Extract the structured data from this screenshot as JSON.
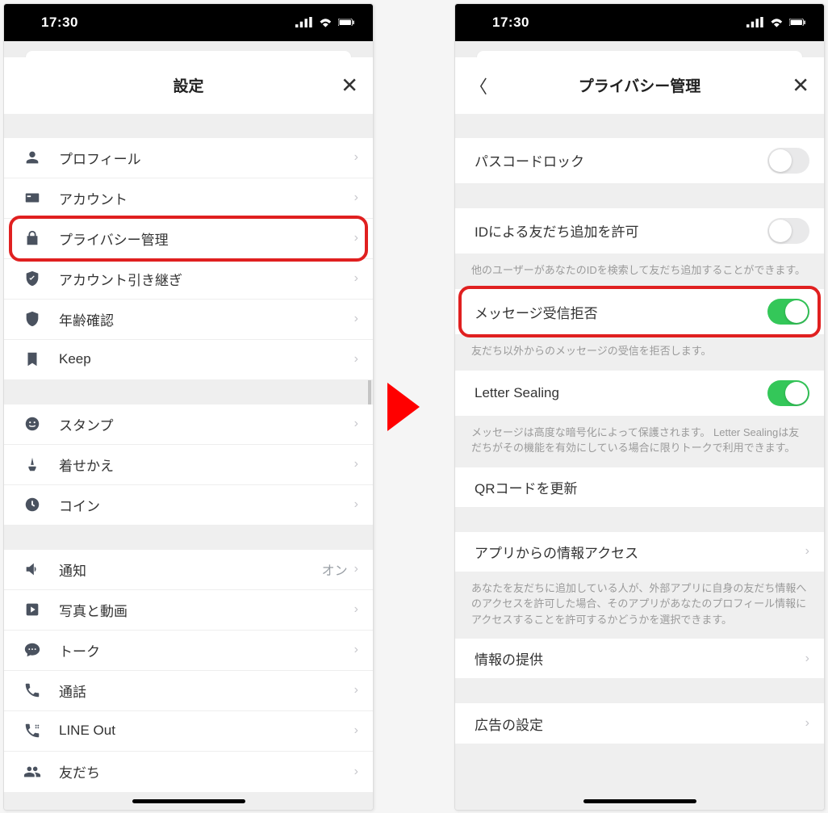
{
  "statusbar": {
    "time": "17:30"
  },
  "left": {
    "title": "設定",
    "groups": [
      [
        {
          "icon": "person",
          "label": "プロフィール"
        },
        {
          "icon": "id-card",
          "label": "アカウント"
        },
        {
          "icon": "lock",
          "label": "プライバシー管理",
          "highlight": true
        },
        {
          "icon": "shield-check",
          "label": "アカウント引き継ぎ"
        },
        {
          "icon": "shield",
          "label": "年齢確認"
        },
        {
          "icon": "bookmark",
          "label": "Keep"
        }
      ],
      [
        {
          "icon": "smile",
          "label": "スタンプ"
        },
        {
          "icon": "brush",
          "label": "着せかえ"
        },
        {
          "icon": "clock",
          "label": "コイン"
        }
      ],
      [
        {
          "icon": "speaker",
          "label": "通知",
          "value": "オン"
        },
        {
          "icon": "play-square",
          "label": "写真と動画"
        },
        {
          "icon": "chat",
          "label": "トーク"
        },
        {
          "icon": "phone",
          "label": "通話"
        },
        {
          "icon": "phone-out",
          "label": "LINE Out"
        },
        {
          "icon": "people",
          "label": "友だち"
        }
      ]
    ]
  },
  "right": {
    "title": "プライバシー管理",
    "items": [
      {
        "type": "toggle",
        "label": "パスコードロック",
        "on": false
      },
      {
        "type": "gap"
      },
      {
        "type": "toggle",
        "label": "IDによる友だち追加を許可",
        "on": false
      },
      {
        "type": "note",
        "text": "他のユーザーがあなたのIDを検索して友だち追加することができます。"
      },
      {
        "type": "toggle",
        "label": "メッセージ受信拒否",
        "on": true,
        "highlight": true
      },
      {
        "type": "note",
        "text": "友だち以外からのメッセージの受信を拒否します。"
      },
      {
        "type": "toggle",
        "label": "Letter Sealing",
        "on": true
      },
      {
        "type": "note",
        "text": "メッセージは高度な暗号化によって保護されます。 Letter Sealingは友だちがその機能を有効にしている場合に限りトークで利用できます。"
      },
      {
        "type": "link",
        "label": "QRコードを更新"
      },
      {
        "type": "gap"
      },
      {
        "type": "link",
        "label": "アプリからの情報アクセス",
        "chevron": true
      },
      {
        "type": "note",
        "text": "あなたを友だちに追加している人が、外部アプリに自身の友だち情報へのアクセスを許可した場合、そのアプリがあなたのプロフィール情報にアクセスすることを許可するかどうかを選択できます。"
      },
      {
        "type": "link",
        "label": "情報の提供",
        "chevron": true
      },
      {
        "type": "gap"
      },
      {
        "type": "link",
        "label": "広告の設定",
        "chevron": true
      }
    ]
  }
}
